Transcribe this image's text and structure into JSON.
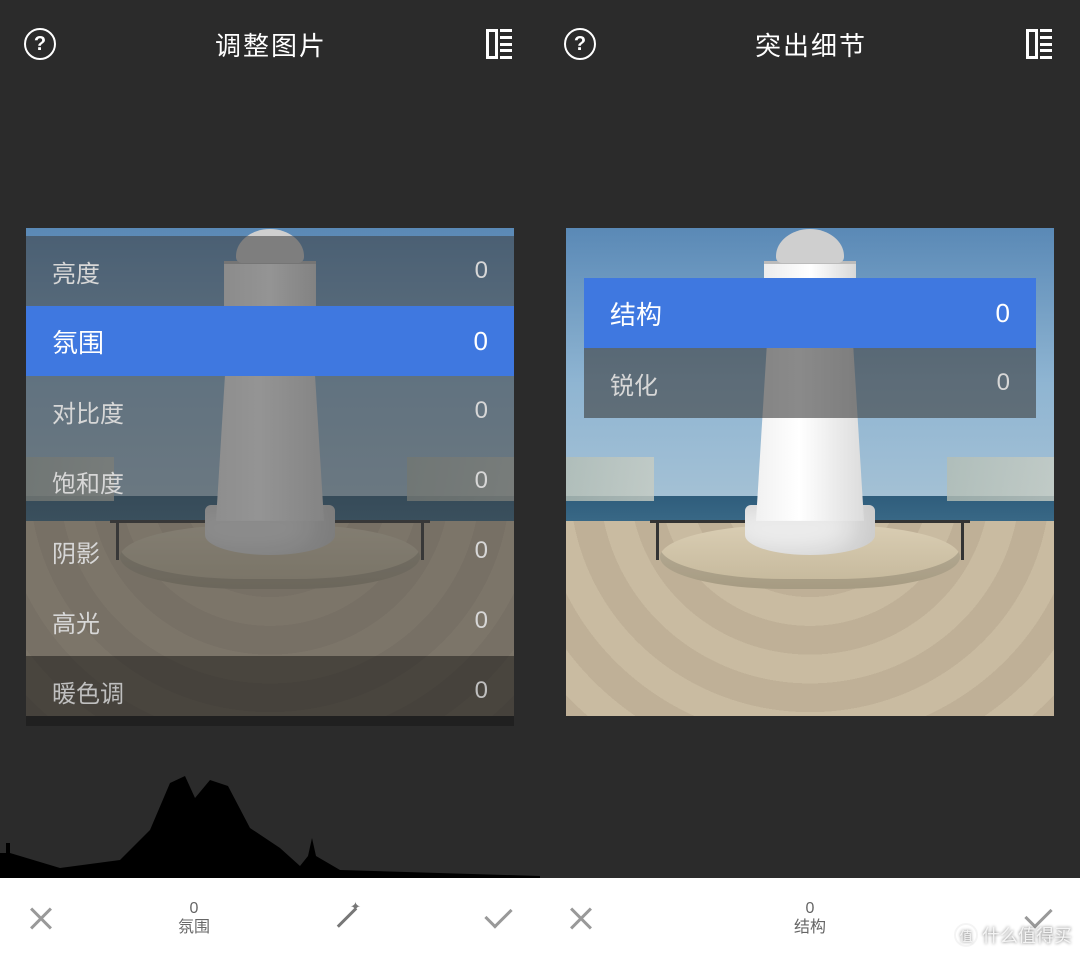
{
  "left": {
    "header": {
      "title": "调整图片"
    },
    "options": [
      {
        "label": "亮度",
        "value": "0",
        "state": "dim"
      },
      {
        "label": "氛围",
        "value": "0",
        "state": "sel"
      },
      {
        "label": "对比度",
        "value": "0",
        "state": "dim"
      },
      {
        "label": "饱和度",
        "value": "0",
        "state": "dim"
      },
      {
        "label": "阴影",
        "value": "0",
        "state": "dim"
      },
      {
        "label": "高光",
        "value": "0",
        "state": "dim"
      },
      {
        "label": "暖色调",
        "value": "0",
        "state": "below-img"
      }
    ],
    "toolbar": {
      "value": "0",
      "param": "氛围"
    }
  },
  "right": {
    "header": {
      "title": "突出细节"
    },
    "options": [
      {
        "label": "结构",
        "value": "0",
        "state": "sel"
      },
      {
        "label": "锐化",
        "value": "0",
        "state": "dim"
      }
    ],
    "toolbar": {
      "value": "0",
      "param": "结构"
    }
  },
  "watermark": {
    "badge": "值",
    "text": "什么值得买"
  }
}
